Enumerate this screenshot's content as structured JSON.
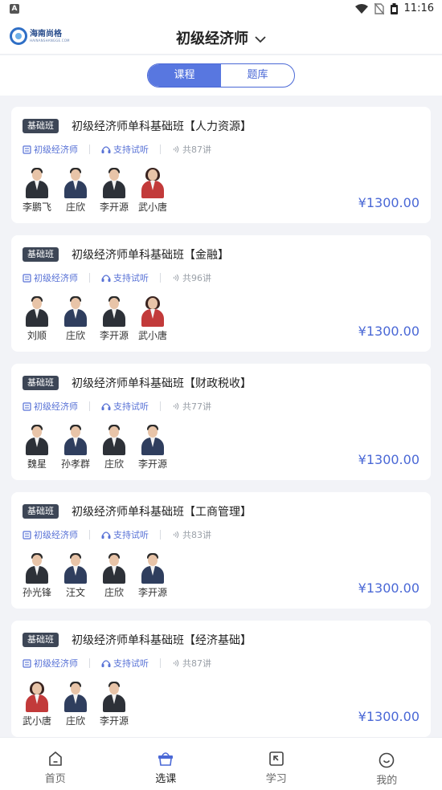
{
  "status_bar": {
    "time": "11:16",
    "left_badge": "A"
  },
  "header": {
    "logo_text": "海南尚格",
    "logo_sub": "HAINANSHANGGE.COM",
    "title": "初级经济师"
  },
  "segment": {
    "tabs": [
      "课程",
      "题库"
    ],
    "active": 0
  },
  "courses": [
    {
      "tag": "基础班",
      "title": "初级经济师单科基础班【人力资源】",
      "category": "初级经济师",
      "trial": "支持试听",
      "lessons": "共87讲",
      "teachers": [
        "李鹏飞",
        "庄欣",
        "李开源",
        "武小唐"
      ],
      "price": "¥1300.00"
    },
    {
      "tag": "基础班",
      "title": "初级经济师单科基础班【金融】",
      "category": "初级经济师",
      "trial": "支持试听",
      "lessons": "共96讲",
      "teachers": [
        "刘顺",
        "庄欣",
        "李开源",
        "武小唐"
      ],
      "price": "¥1300.00"
    },
    {
      "tag": "基础班",
      "title": "初级经济师单科基础班【财政税收】",
      "category": "初级经济师",
      "trial": "支持试听",
      "lessons": "共77讲",
      "teachers": [
        "魏星",
        "孙孝群",
        "庄欣",
        "李开源"
      ],
      "price": "¥1300.00"
    },
    {
      "tag": "基础班",
      "title": "初级经济师单科基础班【工商管理】",
      "category": "初级经济师",
      "trial": "支持试听",
      "lessons": "共83讲",
      "teachers": [
        "孙光锋",
        "汪文",
        "庄欣",
        "李开源"
      ],
      "price": "¥1300.00"
    },
    {
      "tag": "基础班",
      "title": "初级经济师单科基础班【经济基础】",
      "category": "初级经济师",
      "trial": "支持试听",
      "lessons": "共87讲",
      "teachers": [
        "武小唐",
        "庄欣",
        "李开源"
      ],
      "price": "¥1300.00"
    }
  ],
  "tabbar": {
    "items": [
      "首页",
      "选课",
      "学习",
      "我的"
    ],
    "active": 1
  },
  "colors": {
    "accent": "#4a68d6",
    "tag_bg": "#3d4656",
    "background": "#f2f3f7"
  }
}
